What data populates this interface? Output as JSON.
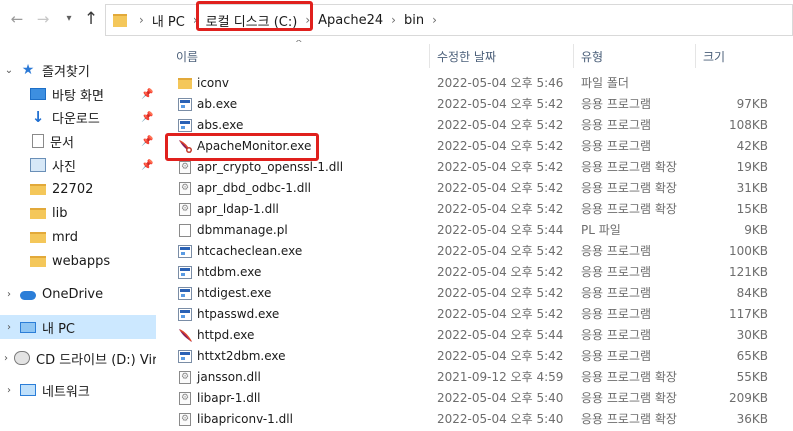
{
  "address": {
    "crumbs": [
      "내 PC",
      "로컬 디스크 (C:)",
      "Apache24",
      "bin"
    ]
  },
  "nav": {
    "quick_access": "즐겨찾기",
    "desktop": "바탕 화면",
    "downloads": "다운로드",
    "documents": "문서",
    "pictures": "사진",
    "folder1": "22702",
    "folder2": "lib",
    "folder3": "mrd",
    "folder4": "webapps",
    "onedrive": "OneDrive",
    "this_pc": "내 PC",
    "cd_drive": "CD 드라이브 (D:) Vir",
    "network": "네트워크"
  },
  "columns": {
    "name": "이름",
    "date": "수정한 날짜",
    "type": "유형",
    "size": "크기"
  },
  "files": [
    {
      "name": "iconv",
      "date": "2022-05-04 오후 5:46",
      "type": "파일 폴더",
      "size": "",
      "icon": "folder"
    },
    {
      "name": "ab.exe",
      "date": "2022-05-04 오후 5:42",
      "type": "응용 프로그램",
      "size": "97KB",
      "icon": "exe"
    },
    {
      "name": "abs.exe",
      "date": "2022-05-04 오후 5:42",
      "type": "응용 프로그램",
      "size": "108KB",
      "icon": "exe"
    },
    {
      "name": "ApacheMonitor.exe",
      "date": "2022-05-04 오후 5:42",
      "type": "응용 프로그램",
      "size": "42KB",
      "icon": "apache"
    },
    {
      "name": "apr_crypto_openssl-1.dll",
      "date": "2022-05-04 오후 5:42",
      "type": "응용 프로그램 확장",
      "size": "19KB",
      "icon": "dll"
    },
    {
      "name": "apr_dbd_odbc-1.dll",
      "date": "2022-05-04 오후 5:42",
      "type": "응용 프로그램 확장",
      "size": "31KB",
      "icon": "dll"
    },
    {
      "name": "apr_ldap-1.dll",
      "date": "2022-05-04 오후 5:42",
      "type": "응용 프로그램 확장",
      "size": "15KB",
      "icon": "dll"
    },
    {
      "name": "dbmmanage.pl",
      "date": "2022-05-04 오후 5:44",
      "type": "PL 파일",
      "size": "9KB",
      "icon": "pl"
    },
    {
      "name": "htcacheclean.exe",
      "date": "2022-05-04 오후 5:42",
      "type": "응용 프로그램",
      "size": "100KB",
      "icon": "exe"
    },
    {
      "name": "htdbm.exe",
      "date": "2022-05-04 오후 5:42",
      "type": "응용 프로그램",
      "size": "121KB",
      "icon": "exe"
    },
    {
      "name": "htdigest.exe",
      "date": "2022-05-04 오후 5:42",
      "type": "응용 프로그램",
      "size": "84KB",
      "icon": "exe"
    },
    {
      "name": "htpasswd.exe",
      "date": "2022-05-04 오후 5:42",
      "type": "응용 프로그램",
      "size": "117KB",
      "icon": "exe"
    },
    {
      "name": "httpd.exe",
      "date": "2022-05-04 오후 5:44",
      "type": "응용 프로그램",
      "size": "30KB",
      "icon": "apache"
    },
    {
      "name": "httxt2dbm.exe",
      "date": "2022-05-04 오후 5:42",
      "type": "응용 프로그램",
      "size": "65KB",
      "icon": "exe"
    },
    {
      "name": "jansson.dll",
      "date": "2021-09-12 오후 4:59",
      "type": "응용 프로그램 확장",
      "size": "55KB",
      "icon": "dll"
    },
    {
      "name": "libapr-1.dll",
      "date": "2022-05-04 오후 5:40",
      "type": "응용 프로그램 확장",
      "size": "209KB",
      "icon": "dll"
    },
    {
      "name": "libapriconv-1.dll",
      "date": "2022-05-04 오후 5:40",
      "type": "응용 프로그램 확장",
      "size": "36KB",
      "icon": "dll"
    }
  ],
  "colors": {
    "highlight": "#e0201d",
    "selected_bg": "#cce8ff",
    "folder": "#f4c75a"
  }
}
